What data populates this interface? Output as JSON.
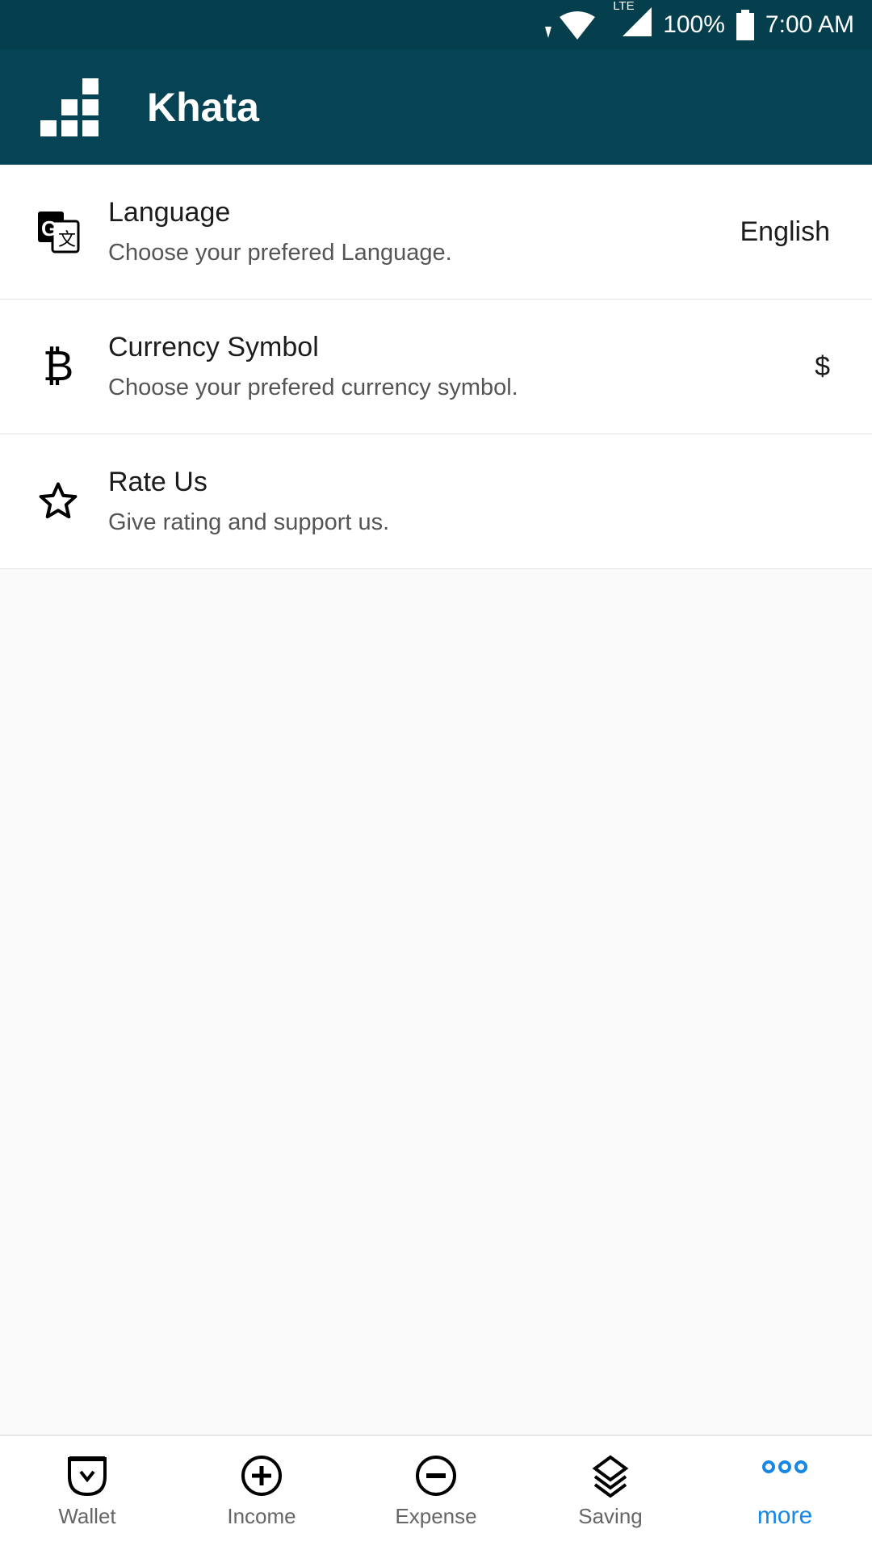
{
  "status_bar": {
    "battery": "100%",
    "time": "7:00 AM",
    "network": "LTE"
  },
  "app_bar": {
    "title": "Khata"
  },
  "settings": [
    {
      "title": "Language",
      "subtitle": "Choose your prefered Language.",
      "value": "English",
      "icon": "translate-icon"
    },
    {
      "title": "Currency Symbol",
      "subtitle": "Choose your prefered currency symbol.",
      "value": "$",
      "icon": "bitcoin-icon"
    },
    {
      "title": "Rate Us",
      "subtitle": "Give rating and support us.",
      "icon": "star-icon"
    }
  ],
  "nav": [
    {
      "label": "Wallet",
      "icon": "wallet-icon"
    },
    {
      "label": "Income",
      "icon": "plus-circle-icon"
    },
    {
      "label": "Expense",
      "icon": "minus-circle-icon"
    },
    {
      "label": "Saving",
      "icon": "layers-icon"
    },
    {
      "label": "more",
      "icon": "more-icon",
      "active": true
    }
  ],
  "colors": {
    "primary": "#064455",
    "status": "#053e4c",
    "accent": "#1787e5"
  }
}
